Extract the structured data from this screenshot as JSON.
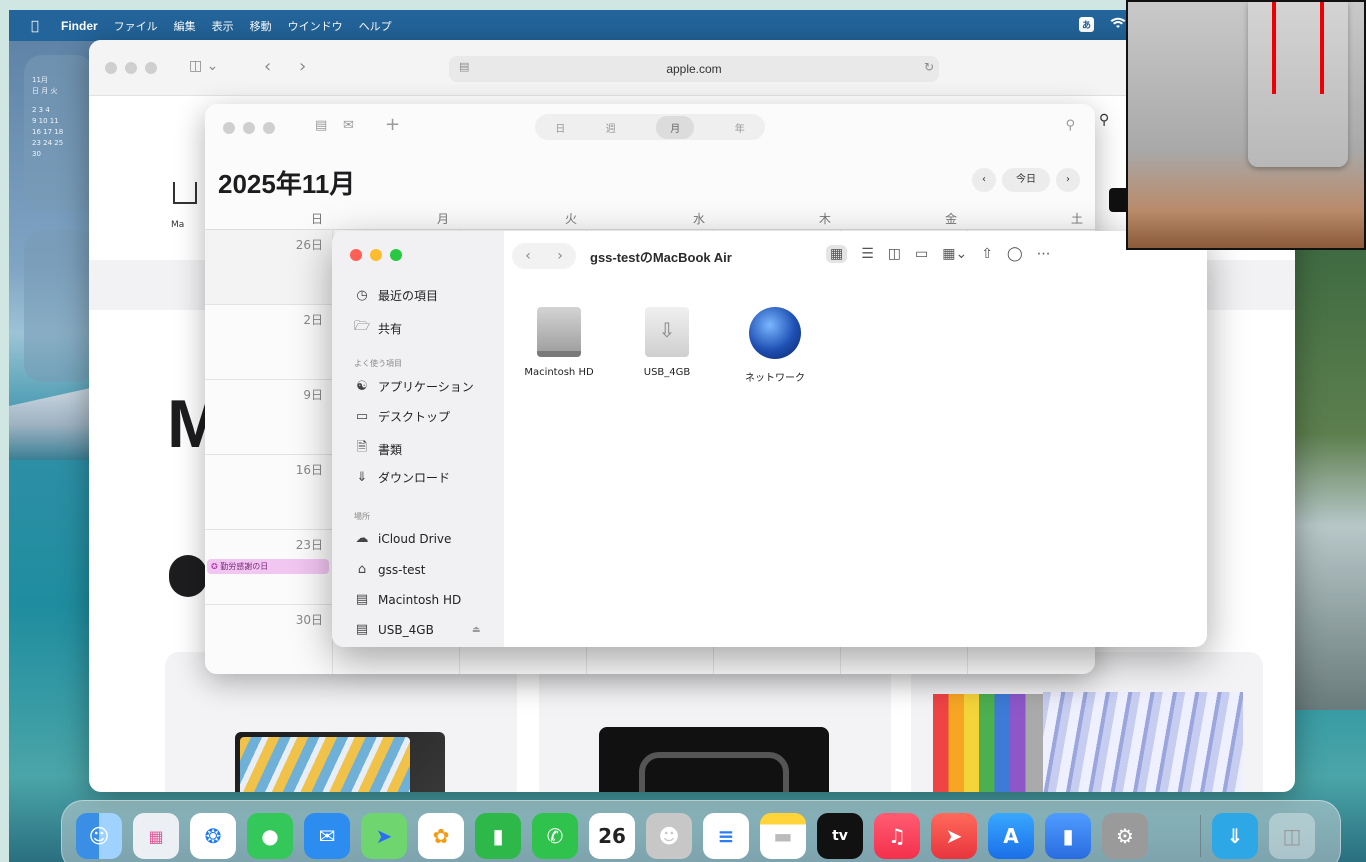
{
  "menubar": {
    "app": "Finder",
    "menus": [
      "ファイル",
      "編集",
      "表示",
      "移動",
      "ウインドウ",
      "ヘルプ"
    ],
    "ime": "あ"
  },
  "widget_calendar": {
    "month": "11月",
    "weekdays": "日 月 火",
    "rows": [
      "2  3  4",
      "9  10  11",
      "16  17  18",
      "23  24  25",
      "30"
    ]
  },
  "safari": {
    "address": "apple.com",
    "hero_letter": "M",
    "sidebar_label": "Ma"
  },
  "calendar": {
    "segments": [
      "日",
      "週",
      "月",
      "年"
    ],
    "selected_segment": "月",
    "title": "2025年11月",
    "today": "今日",
    "weekdays": [
      "日",
      "月",
      "火",
      "水",
      "木",
      "金",
      "土"
    ],
    "dates": [
      "26日",
      "2日",
      "9日",
      "16日",
      "23日",
      "30日"
    ],
    "event": "勤労感謝の日"
  },
  "finder": {
    "title": "gss-testのMacBook Air",
    "sidebar": {
      "recents": "最近の項目",
      "shared": "共有",
      "favorites_header": "よく使う項目",
      "favorites": [
        "アプリケーション",
        "デスクトップ",
        "書類",
        "ダウンロード"
      ],
      "locations_header": "場所",
      "locations": [
        "iCloud Drive",
        "gss-test",
        "Macintosh HD",
        "USB_4GB"
      ]
    },
    "items": [
      "Macintosh HD",
      "USB_4GB",
      "ネットワーク"
    ]
  },
  "dock": {
    "calendar_day": "26",
    "tv_label": "tv"
  }
}
